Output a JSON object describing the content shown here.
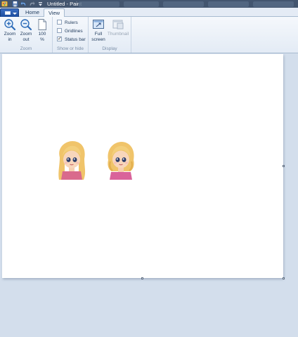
{
  "window": {
    "title": "Untitled - Paint",
    "quick_access": [
      "paint-icon",
      "save-icon",
      "undo-icon",
      "redo-icon",
      "customize-icon"
    ]
  },
  "menu": {
    "app_button_icon": "paint-menu-icon",
    "tabs": [
      {
        "label": "Home",
        "active": false
      },
      {
        "label": "View",
        "active": true
      }
    ]
  },
  "ribbon": {
    "zoom": {
      "group_label": "Zoom",
      "zoom_in": {
        "line1": "Zoom",
        "line2": "in",
        "icon": "zoom-in-icon"
      },
      "zoom_out": {
        "line1": "Zoom",
        "line2": "out",
        "icon": "zoom-out-icon"
      },
      "actual": {
        "line1": "100",
        "line2": "%",
        "icon": "page-100-icon"
      }
    },
    "show_hide": {
      "group_label": "Show or hide",
      "rulers": {
        "label": "Rulers",
        "checked": false
      },
      "gridlines": {
        "label": "Gridlines",
        "checked": false
      },
      "status_bar": {
        "label": "Status bar",
        "checked": true,
        "mark": "✓"
      }
    },
    "display": {
      "group_label": "Display",
      "full_screen": {
        "line1": "Full",
        "line2": "screen",
        "icon": "full-screen-icon"
      },
      "thumbnail": {
        "label": "Thumbnail",
        "icon": "thumbnail-icon",
        "enabled": false
      }
    }
  },
  "canvas": {
    "background": "#ffffff",
    "images": [
      "blonde-girl-avatar-1",
      "blonde-girl-avatar-2"
    ]
  },
  "colors": {
    "titlebar": "#43556f",
    "ribbon": "#f5f8fc",
    "workspace": "#d3deec",
    "app_button": "#2a5db0",
    "text": "#1e395b"
  }
}
